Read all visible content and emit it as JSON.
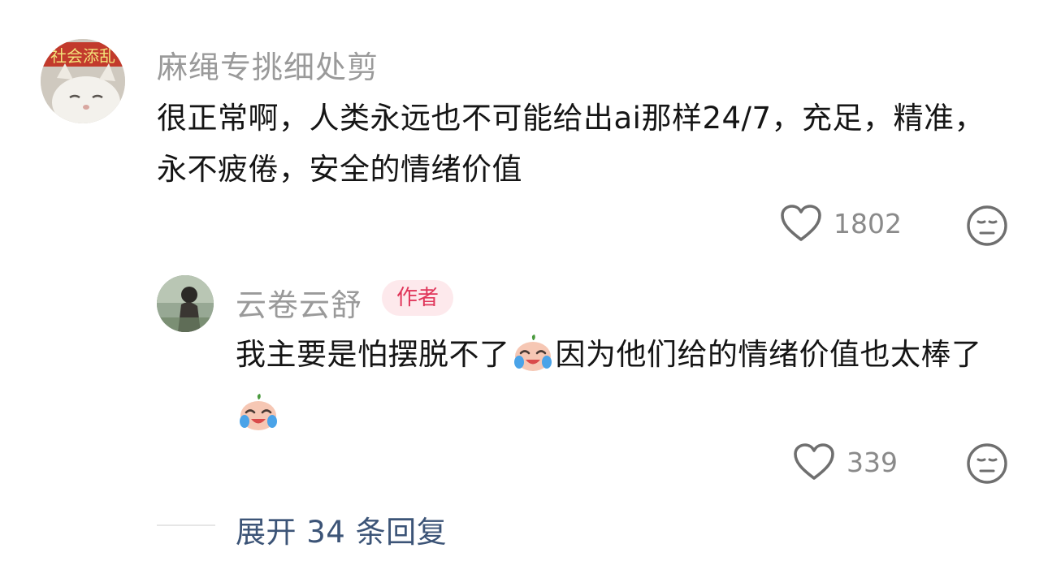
{
  "comment": {
    "username": "麻绳专挑细处剪",
    "avatar_banner_text": "社会添乱",
    "text": "很正常啊，人类永远也不可能给出ai那样24/7，充足，精准，永不疲倦，安全的情绪价值",
    "likes": "1802",
    "like_icon": "heart-outline-icon",
    "reaction_icon": "neutral-face-icon"
  },
  "reply": {
    "username": "云卷云舒",
    "badge": "作者",
    "text_part1": "我主要是怕摆脱不了",
    "text_part2": "因为他们给的情绪价值也太棒了",
    "emoji": "crying-laughing-face-emoji",
    "likes": "339",
    "like_icon": "heart-outline-icon",
    "reaction_icon": "neutral-face-icon"
  },
  "expand_replies": {
    "label": "展开 34 条回复"
  },
  "colors": {
    "username": "#9a9a9a",
    "badge_text": "#e0365a",
    "badge_bg": "#fde9ec",
    "expand_link": "#3c5477"
  }
}
